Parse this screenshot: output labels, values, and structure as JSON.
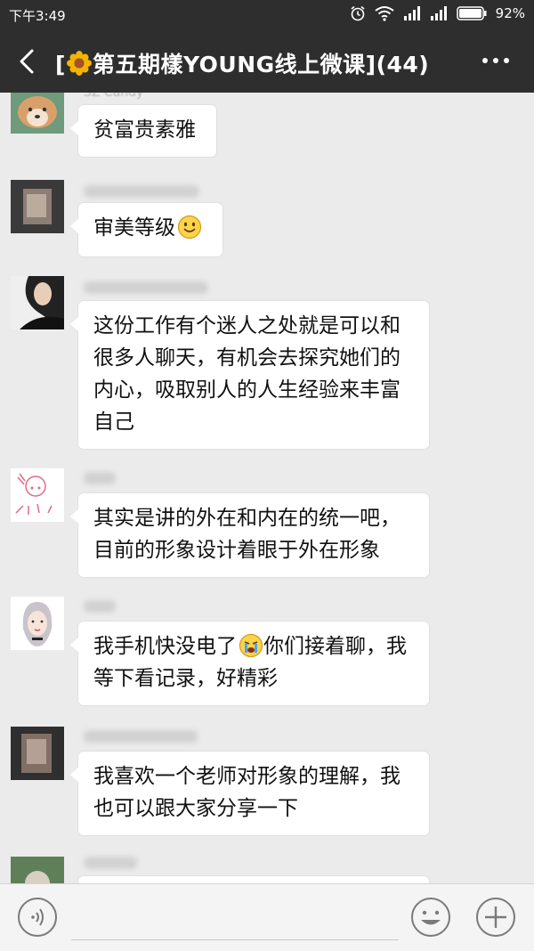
{
  "status_bar": {
    "time": "下午3:49",
    "battery": "92%",
    "icons": [
      "alarm-icon",
      "wifi-icon",
      "signal-icon",
      "signal-icon",
      "battery-icon"
    ]
  },
  "header": {
    "title_prefix": "[",
    "title_text": "第五期樣YOUNG线上微课](44)",
    "title_emoji": "flower-icon"
  },
  "messages": [
    {
      "sender": "SZ Candy",
      "text": "贫富贵素雅"
    },
    {
      "sender": "",
      "text": "审美等级",
      "emoji": "smile-emoji"
    },
    {
      "sender": "",
      "lines": [
        "这份工作有个迷人之处就是可以和",
        "很多人聊天，有机会去探究她们的",
        "内心，吸取别人的人生经验来丰富",
        "自己"
      ]
    },
    {
      "sender": "",
      "lines": [
        "其实是讲的外在和内在的统一吧，",
        "目前的形象设计着眼于外在形象"
      ]
    },
    {
      "sender": "",
      "lines_a": "我手机快没电了",
      "lines_a_rest": "你们接着聊，我",
      "emoji": "crying-emoji",
      "line2": "等下看记录，好精彩"
    },
    {
      "sender": "",
      "lines": [
        "我喜欢一个老师对形象的理解，我",
        "也可以跟大家分享一下"
      ]
    }
  ],
  "colors": {
    "header_bg": "#2e2e2e",
    "chat_bg": "#ebebeb",
    "bubble_bg": "#ffffff"
  }
}
